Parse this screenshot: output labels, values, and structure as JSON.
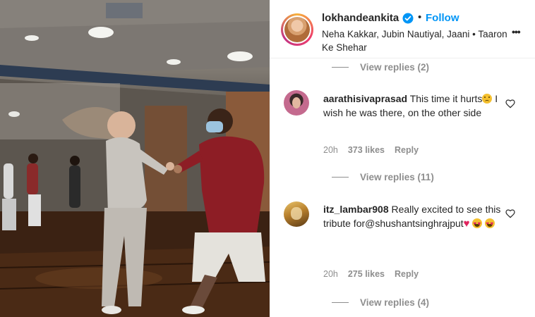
{
  "post": {
    "username": "lokhandeankita",
    "dot": "•",
    "follow_label": "Follow",
    "audio_line": "Neha Kakkar, Jubin Nautiyal, Jaani • Taaron Ke Shehar",
    "more_icon": "more-options-icon"
  },
  "comments": [
    {
      "view_replies_above": "View replies (2)"
    },
    {
      "username": "aarathisivaprasad",
      "text_part1": "This time it hurts",
      "emoji": "sad-face-emoji",
      "text_part2": " I wish he was there, on the other side",
      "time": "20h",
      "likes": "373 likes",
      "reply_label": "Reply",
      "view_replies": "View replies (11)"
    },
    {
      "username": "itz_lambar908",
      "text_part1": "Really excited to see this tribute for@shushantsinghrajput",
      "emoji": "heart-eyes-emoji",
      "time": "20h",
      "likes": "275 likes",
      "reply_label": "Reply",
      "view_replies": "View replies (4)"
    }
  ],
  "colors": {
    "accent": "#0095f6",
    "muted": "#8e8e8e",
    "text": "#262626",
    "heart": "#e0245e"
  }
}
